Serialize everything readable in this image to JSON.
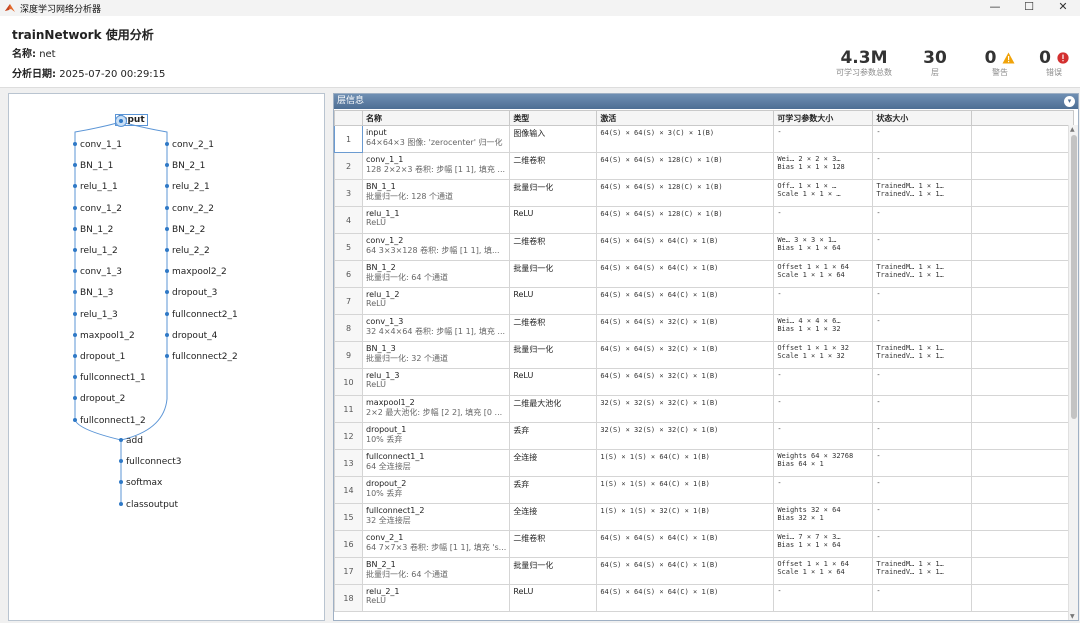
{
  "window": {
    "title": "深度学习网络分析器",
    "minimize": "—",
    "maximize": "☐",
    "close": "✕"
  },
  "header": {
    "network_title": "trainNetwork 使用分析",
    "name_label": "名称:",
    "name_value": "net",
    "date_label": "分析日期:",
    "date_value": "2025-07-20 00:29:15",
    "stats": [
      {
        "value": "4.3M",
        "label": "可学习参数总数"
      },
      {
        "value": "30",
        "label": "层"
      },
      {
        "value": "0",
        "label": "警告"
      },
      {
        "value": "0",
        "label": "错误"
      }
    ]
  },
  "graph": {
    "input": "input",
    "left_branch": [
      "conv_1_1",
      "BN_1_1",
      "relu_1_1",
      "conv_1_2",
      "BN_1_2",
      "relu_1_2",
      "conv_1_3",
      "BN_1_3",
      "relu_1_3",
      "maxpool1_2",
      "dropout_1",
      "fullconnect1_1",
      "dropout_2",
      "fullconnect1_2"
    ],
    "right_branch": [
      "conv_2_1",
      "BN_2_1",
      "relu_2_1",
      "conv_2_2",
      "BN_2_2",
      "relu_2_2",
      "maxpool2_2",
      "dropout_3",
      "fullconnect2_1",
      "dropout_4",
      "fullconnect2_2"
    ],
    "tail": [
      "add",
      "fullconnect3",
      "softmax",
      "classoutput"
    ]
  },
  "layers_panel": {
    "title": "层信息",
    "columns": [
      "",
      "名称",
      "类型",
      "激活",
      "可学习参数大小",
      "状态大小"
    ],
    "rows": [
      {
        "idx": "1",
        "name": "input",
        "desc": "64×64×3 图像: 'zerocenter' 归一化",
        "type": "图像输入",
        "act": "64(S) × 64(S) × 3(C) × 1(B)",
        "params": [
          "-"
        ],
        "state": [
          "-"
        ]
      },
      {
        "idx": "2",
        "name": "conv_1_1",
        "desc": "128 2×2×3 卷积: 步幅 [1 1], 填充 ...",
        "type": "二维卷积",
        "act": "64(S) × 64(S) × 128(C) × 1(B)",
        "params": [
          "Wei… 2 × 2 × 3…",
          "Bias  1 × 1 × 128"
        ],
        "state": [
          "-"
        ]
      },
      {
        "idx": "3",
        "name": "BN_1_1",
        "desc": "批量归一化: 128 个通道",
        "type": "批量归一化",
        "act": "64(S) × 64(S) × 128(C) × 1(B)",
        "params": [
          "Off… 1 × 1 × …",
          "Scale  1 × 1 × …"
        ],
        "state": [
          "TrainedM… 1 × 1…",
          "TrainedV… 1 × 1…"
        ]
      },
      {
        "idx": "4",
        "name": "relu_1_1",
        "desc": "ReLU",
        "type": "ReLU",
        "act": "64(S) × 64(S) × 128(C) × 1(B)",
        "params": [
          "-"
        ],
        "state": [
          "-"
        ]
      },
      {
        "idx": "5",
        "name": "conv_1_2",
        "desc": "64 3×3×128 卷积: 步幅 [1 1], 填...",
        "type": "二维卷积",
        "act": "64(S) × 64(S) × 64(C) × 1(B)",
        "params": [
          "We… 3 × 3 × 1…",
          "Bias  1 × 1 × 64"
        ],
        "state": [
          "-"
        ]
      },
      {
        "idx": "6",
        "name": "BN_1_2",
        "desc": "批量归一化: 64 个通道",
        "type": "批量归一化",
        "act": "64(S) × 64(S) × 64(C) × 1(B)",
        "params": [
          "Offset 1 × 1 × 64",
          "Scale  1 × 1 × 64"
        ],
        "state": [
          "TrainedM… 1 × 1…",
          "TrainedV… 1 × 1…"
        ]
      },
      {
        "idx": "7",
        "name": "relu_1_2",
        "desc": "ReLU",
        "type": "ReLU",
        "act": "64(S) × 64(S) × 64(C) × 1(B)",
        "params": [
          "-"
        ],
        "state": [
          "-"
        ]
      },
      {
        "idx": "8",
        "name": "conv_1_3",
        "desc": "32 4×4×64 卷积: 步幅 [1 1], 填充 ...",
        "type": "二维卷积",
        "act": "64(S) × 64(S) × 32(C) × 1(B)",
        "params": [
          "Wei… 4 × 4 × 6…",
          "Bias  1 × 1 × 32"
        ],
        "state": [
          "-"
        ]
      },
      {
        "idx": "9",
        "name": "BN_1_3",
        "desc": "批量归一化: 32 个通道",
        "type": "批量归一化",
        "act": "64(S) × 64(S) × 32(C) × 1(B)",
        "params": [
          "Offset 1 × 1 × 32",
          "Scale  1 × 1 × 32"
        ],
        "state": [
          "TrainedM… 1 × 1…",
          "TrainedV… 1 × 1…"
        ]
      },
      {
        "idx": "10",
        "name": "relu_1_3",
        "desc": "ReLU",
        "type": "ReLU",
        "act": "64(S) × 64(S) × 32(C) × 1(B)",
        "params": [
          "-"
        ],
        "state": [
          "-"
        ]
      },
      {
        "idx": "11",
        "name": "maxpool1_2",
        "desc": "2×2 最大池化: 步幅 [2 2], 填充 [0 ...",
        "type": "二维最大池化",
        "act": "32(S) × 32(S) × 32(C) × 1(B)",
        "params": [
          "-"
        ],
        "state": [
          "-"
        ]
      },
      {
        "idx": "12",
        "name": "dropout_1",
        "desc": "10% 丢弃",
        "type": "丢弃",
        "act": "32(S) × 32(S) × 32(C) × 1(B)",
        "params": [
          "-"
        ],
        "state": [
          "-"
        ]
      },
      {
        "idx": "13",
        "name": "fullconnect1_1",
        "desc": "64 全连接层",
        "type": "全连接",
        "act": "1(S) × 1(S) × 64(C) × 1(B)",
        "params": [
          "Weights 64 × 32768",
          "Bias    64 × 1"
        ],
        "state": [
          "-"
        ]
      },
      {
        "idx": "14",
        "name": "dropout_2",
        "desc": "10% 丢弃",
        "type": "丢弃",
        "act": "1(S) × 1(S) × 64(C) × 1(B)",
        "params": [
          "-"
        ],
        "state": [
          "-"
        ]
      },
      {
        "idx": "15",
        "name": "fullconnect1_2",
        "desc": "32 全连接层",
        "type": "全连接",
        "act": "1(S) × 1(S) × 32(C) × 1(B)",
        "params": [
          "Weights 32 × 64",
          "Bias    32 × 1"
        ],
        "state": [
          "-"
        ]
      },
      {
        "idx": "16",
        "name": "conv_2_1",
        "desc": "64 7×7×3 卷积: 步幅 [1 1], 填充 's...",
        "type": "二维卷积",
        "act": "64(S) × 64(S) × 64(C) × 1(B)",
        "params": [
          "Wei… 7 × 7 × 3…",
          "Bias  1 × 1 × 64"
        ],
        "state": [
          "-"
        ]
      },
      {
        "idx": "17",
        "name": "BN_2_1",
        "desc": "批量归一化: 64 个通道",
        "type": "批量归一化",
        "act": "64(S) × 64(S) × 64(C) × 1(B)",
        "params": [
          "Offset 1 × 1 × 64",
          "Scale  1 × 1 × 64"
        ],
        "state": [
          "TrainedM… 1 × 1…",
          "TrainedV… 1 × 1…"
        ]
      },
      {
        "idx": "18",
        "name": "relu_2_1",
        "desc": "ReLU",
        "type": "ReLU",
        "act": "64(S) × 64(S) × 64(C) × 1(B)",
        "params": [
          "-"
        ],
        "state": [
          "-"
        ]
      }
    ]
  },
  "colors": {
    "accent": "#4d6e94",
    "node": "#2f79c6",
    "warning": "#f0a30a",
    "error": "#d32f2f"
  }
}
